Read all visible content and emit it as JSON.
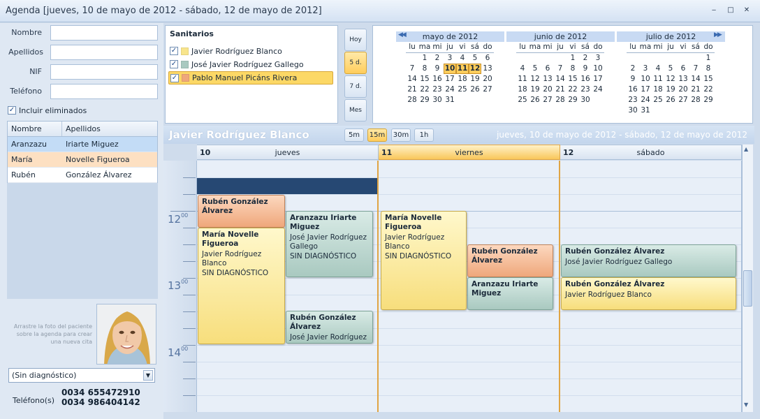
{
  "window": {
    "title": "Agenda [jueves, 10 de mayo de 2012 - sábado, 12 de mayo de 2012]",
    "controls": [
      "‒",
      "□",
      "✕"
    ]
  },
  "search": {
    "nombre_label": "Nombre",
    "apellidos_label": "Apellidos",
    "nif_label": "NIF",
    "telefono_label": "Teléfono",
    "include_deleted_label": "Incluir eliminados"
  },
  "patients": {
    "columns": [
      "Nombre",
      "Apellidos"
    ],
    "rows": [
      {
        "nombre": "Aranzazu",
        "apellidos": "Iriarte Miguez",
        "color": "#c3dcf6"
      },
      {
        "nombre": "María",
        "apellidos": "Novelle Figueroa",
        "color": "#fde0c2"
      },
      {
        "nombre": "Rubén",
        "apellidos": "González Álvarez",
        "color": "#ffffff"
      }
    ]
  },
  "photo_hint": "Arrastre la foto del paciente sobre la agenda para crear una nueva cita",
  "diagnosis_select": "(Sin diagnóstico)",
  "phones": {
    "label": "Teléfono(s)",
    "numbers": [
      "0034 655472910",
      "0034 986404142"
    ]
  },
  "sanitarios": {
    "title": "Sanitarios",
    "items": [
      {
        "name": "Javier Rodríguez Blanco",
        "color": "#f8e58c",
        "checked": "✓"
      },
      {
        "name": "José Javier Rodríguez Gallego",
        "color": "#a9c9c0",
        "checked": "✓"
      },
      {
        "name": "Pablo Manuel Picáns Rivera",
        "color": "#efa77b",
        "checked": "✓"
      }
    ]
  },
  "view_buttons": [
    "Hoy",
    "5 d.",
    "7 d.",
    "Mes"
  ],
  "minical": {
    "day_names": [
      "lu",
      "ma",
      "mi",
      "ju",
      "vi",
      "sá",
      "do"
    ],
    "months": [
      {
        "name": "mayo de 2012",
        "offset": 1,
        "days": 31,
        "selected": [
          10,
          11,
          12
        ]
      },
      {
        "name": "junio de 2012",
        "offset": 4,
        "days": 30,
        "selected": []
      },
      {
        "name": "julio de 2012",
        "offset": 6,
        "days": 31,
        "selected": []
      }
    ],
    "prev_icon": "◀◀",
    "next_icon": "▶▶"
  },
  "scheduler": {
    "resource_name": "Javier Rodríguez Blanco",
    "time_scales": [
      "5m",
      "15m",
      "30m",
      "1h"
    ],
    "active_scale": "15m",
    "range": "jueves, 10 de mayo de 2012 - sábado, 12 de mayo de 2012",
    "days": [
      {
        "num": "10",
        "name": "jueves"
      },
      {
        "num": "11",
        "name": "viernes"
      },
      {
        "num": "12",
        "name": "sábado"
      }
    ],
    "hours": [
      {
        "h": "12",
        "m": "00"
      },
      {
        "h": "13",
        "m": "00"
      },
      {
        "h": "14",
        "m": "00"
      }
    ],
    "appointments": [
      {
        "title": "Rubén González Álvarez",
        "lines": [],
        "style": "ao"
      },
      {
        "title": "María Novelle Figueroa",
        "lines": [
          "Javier Rodríguez Blanco",
          "SIN DIAGNÓSTICO"
        ],
        "style": "ay"
      },
      {
        "title": "Aranzazu Iriarte Miguez",
        "lines": [
          "José Javier Rodríguez Gallego",
          "SIN DIAGNÓSTICO"
        ],
        "style": "at"
      },
      {
        "title": "Rubén González Álvarez",
        "lines": [
          "José Javier Rodríguez"
        ],
        "style": "at"
      },
      {
        "title": "María Novelle Figueroa",
        "lines": [
          "Javier Rodríguez Blanco",
          "SIN DIAGNÓSTICO"
        ],
        "style": "ay"
      },
      {
        "title": "Rubén González Álvarez",
        "lines": [],
        "style": "ao"
      },
      {
        "title": "Aranzazu Iriarte Miguez",
        "lines": [],
        "style": "at"
      },
      {
        "title": "Rubén González Álvarez",
        "lines": [
          "José Javier Rodríguez Gallego"
        ],
        "style": "at"
      },
      {
        "title": "Rubén González Álvarez",
        "lines": [
          "Javier Rodríguez Blanco"
        ],
        "style": "ay"
      }
    ]
  }
}
